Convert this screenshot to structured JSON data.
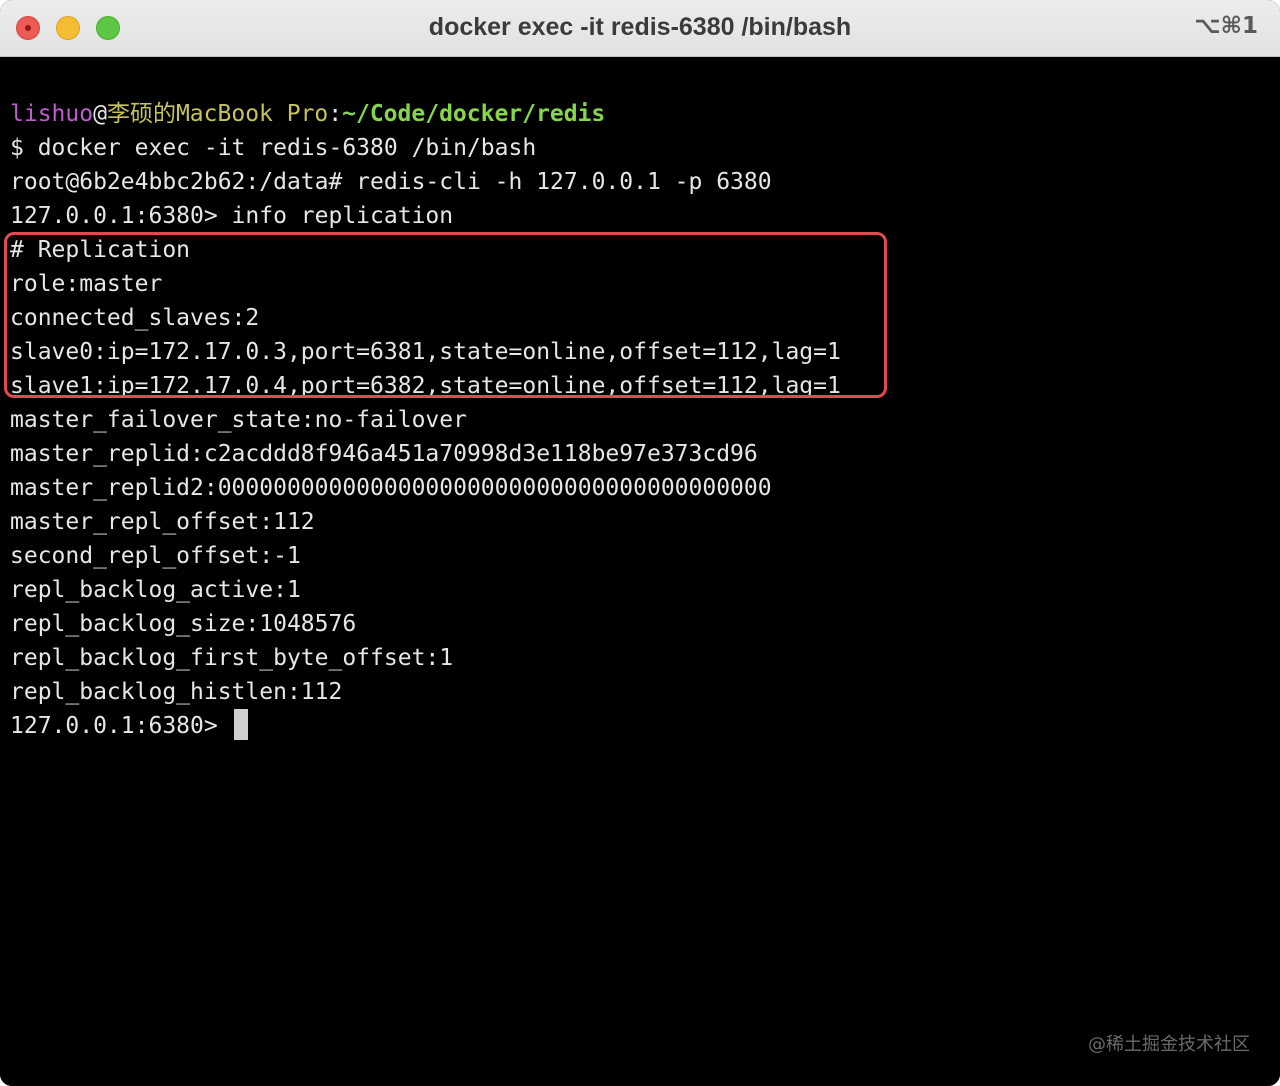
{
  "window": {
    "title": "docker exec -it redis-6380 /bin/bash",
    "shortcut": "⌥⌘1"
  },
  "prompt": {
    "user": "lishuo",
    "at": "@",
    "host": "李硕的MacBook Pro",
    "sep": ":",
    "path": "~/Code/docker/redis"
  },
  "lines": [
    "$ docker exec -it redis-6380 /bin/bash",
    "root@6b2e4bbc2b62:/data# redis-cli -h 127.0.0.1 -p 6380",
    "127.0.0.1:6380> info replication",
    "# Replication",
    "role:master",
    "connected_slaves:2",
    "slave0:ip=172.17.0.3,port=6381,state=online,offset=112,lag=1",
    "slave1:ip=172.17.0.4,port=6382,state=online,offset=112,lag=1",
    "master_failover_state:no-failover",
    "master_replid:c2acddd8f946a451a70998d3e118be97e373cd96",
    "master_replid2:0000000000000000000000000000000000000000",
    "master_repl_offset:112",
    "second_repl_offset:-1",
    "repl_backlog_active:1",
    "repl_backlog_size:1048576",
    "repl_backlog_first_byte_offset:1",
    "repl_backlog_histlen:112"
  ],
  "current_prompt": "127.0.0.1:6380> ",
  "watermark": "@稀土掘金技术社区"
}
